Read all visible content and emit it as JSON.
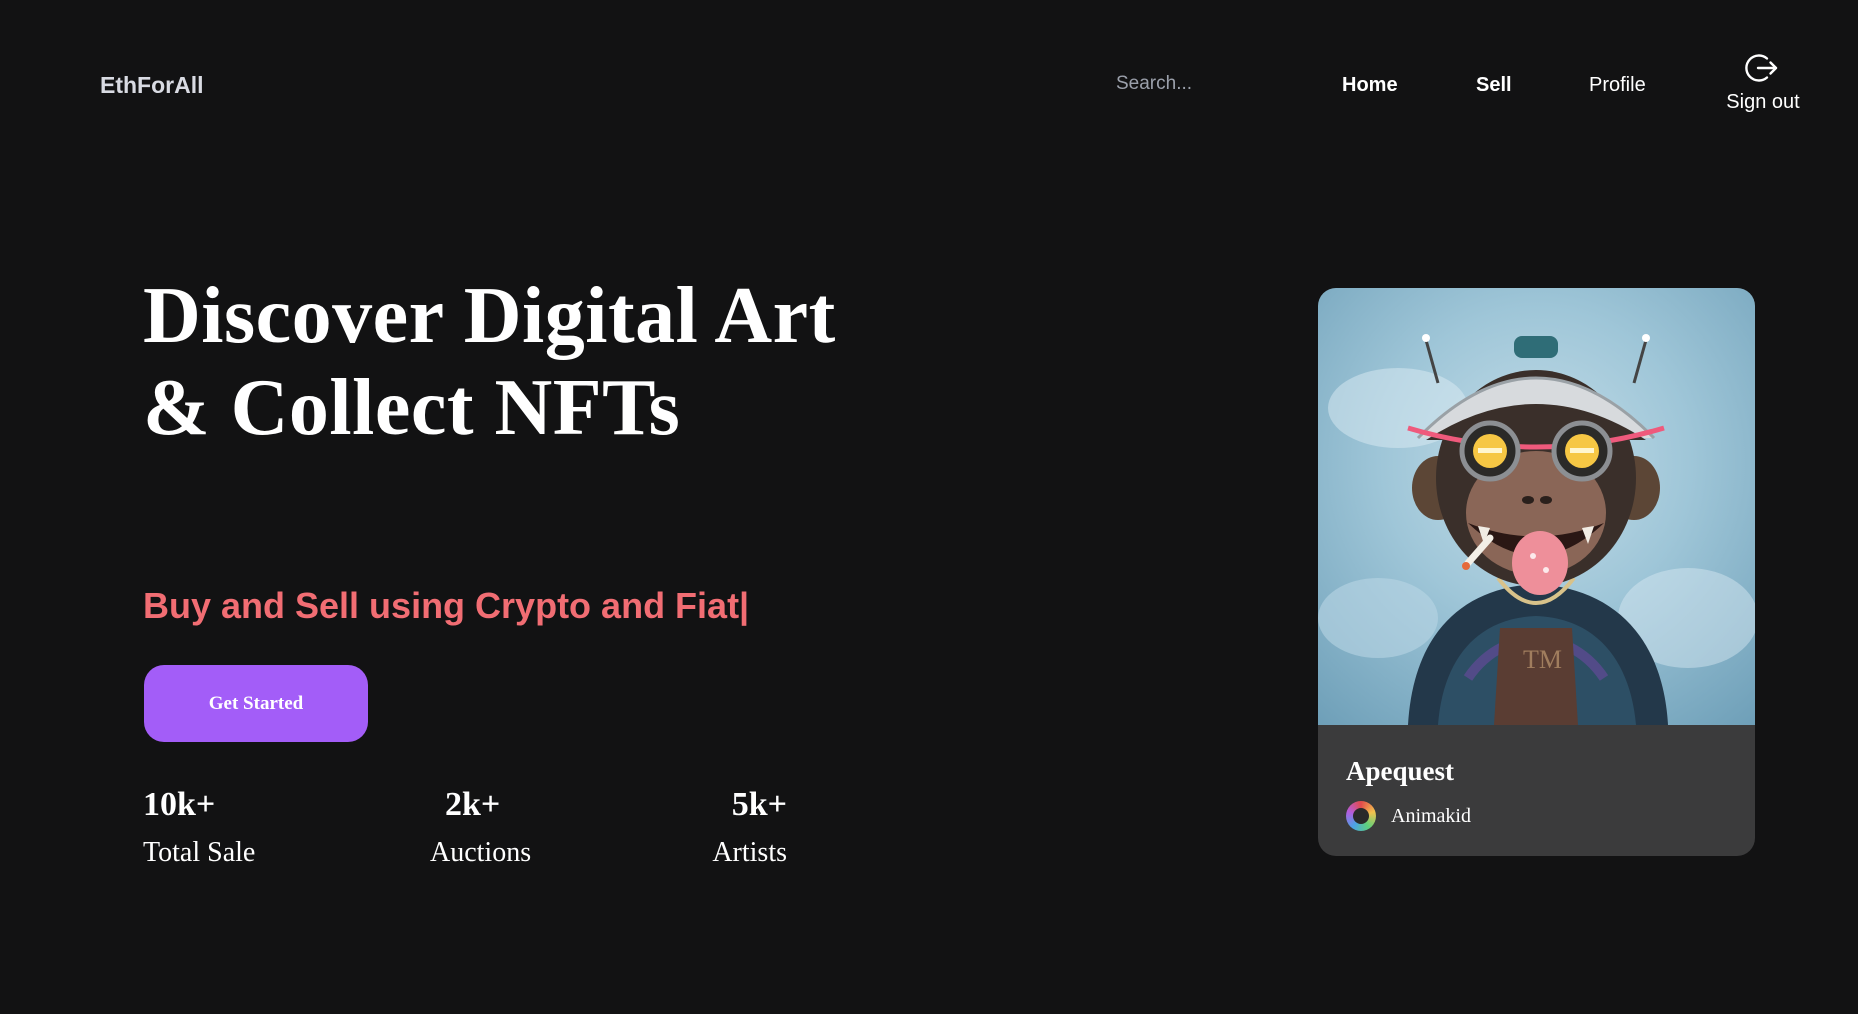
{
  "header": {
    "brand": "EthForAll",
    "search_placeholder": "Search...",
    "nav": {
      "home": "Home",
      "sell": "Sell",
      "profile": "Profile",
      "sign_out": "Sign out"
    }
  },
  "hero": {
    "title": "Discover Digital Art & Collect NFTs",
    "tagline": "Buy and Sell using Crypto and Fiat|",
    "cta_label": "Get Started",
    "stats": [
      {
        "value": "10k+",
        "label": "Total Sale"
      },
      {
        "value": "2k+",
        "label": "Auctions"
      },
      {
        "value": "5k+",
        "label": "Artists"
      }
    ]
  },
  "featured_card": {
    "title": "Apequest",
    "owner": "Animakid"
  },
  "icons": {
    "sign_out": "logout-icon"
  },
  "colors": {
    "background": "#121213",
    "accent": "#a35df8",
    "tagline": "#f16d73",
    "card": "#3b3b3c"
  }
}
